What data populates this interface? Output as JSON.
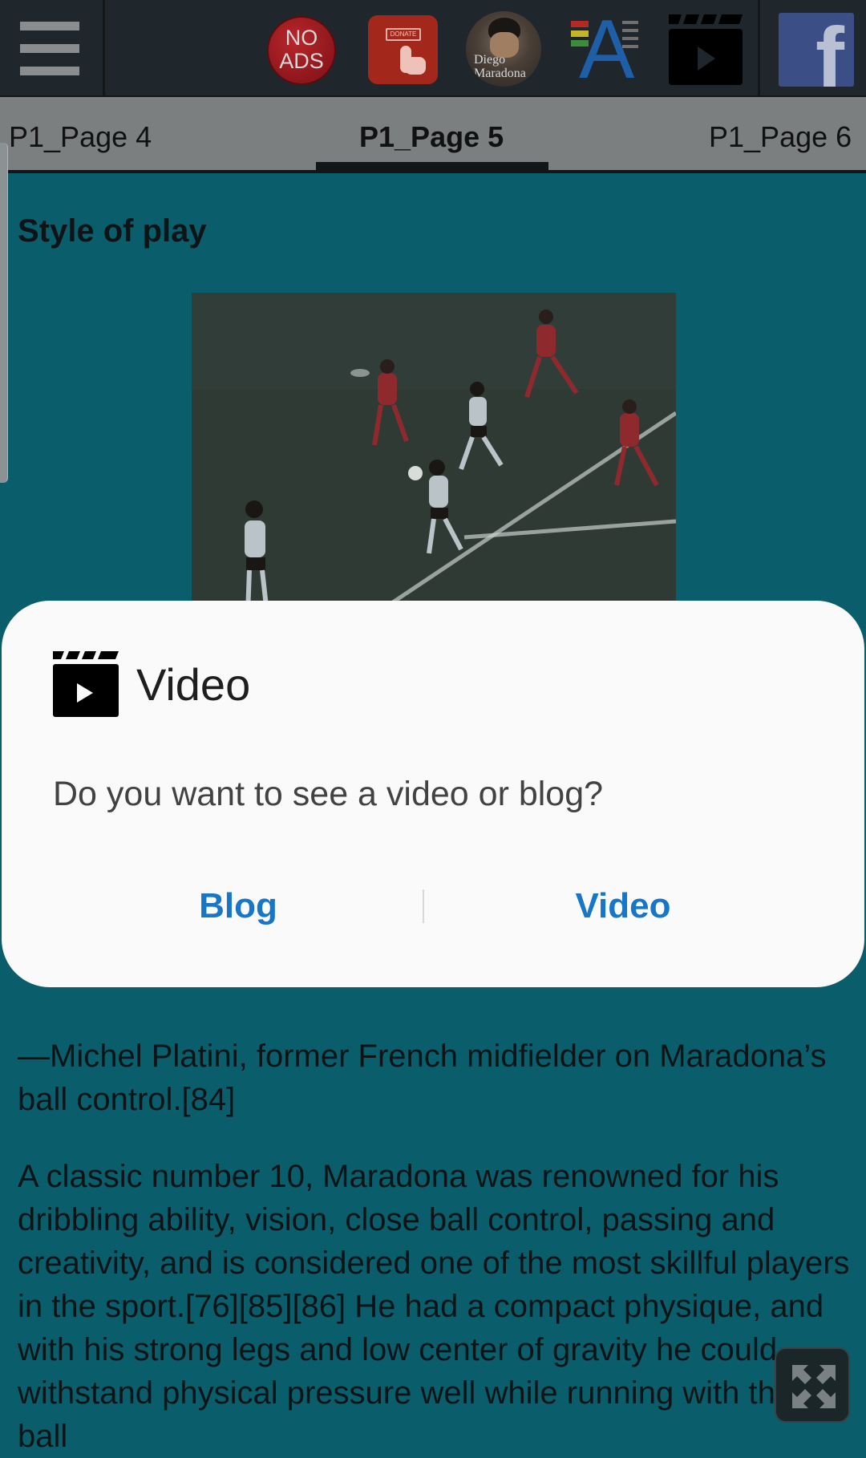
{
  "toolbar": {
    "menu_icon": "hamburger-menu-icon",
    "no_ads_line1": "NO",
    "no_ads_line2": "ADS",
    "donate_label": "DONATE",
    "avatar_line1": "Diego",
    "avatar_line2": "Maradona",
    "font_icon": "font-size-icon",
    "video_icon": "clapperboard-icon",
    "facebook_icon": "facebook-icon"
  },
  "tabs": [
    {
      "label": "P1_Page 4"
    },
    {
      "label": "P1_Page 5",
      "active": true
    },
    {
      "label": "P1_Page 6"
    }
  ],
  "content": {
    "heading": "Style of play",
    "quote": "—Michel Platini, former French midfielder on Maradona’s ball control.[84]",
    "paragraph": "A classic number 10, Maradona was renowned for his dribbling ability, vision, close ball control, passing and creativity, and is considered one of the most skillful players in the sport.[76][85][86] He had a compact physique, and with his strong legs and low center of gravity he could withstand physical pressure well while running with the ball"
  },
  "dialog": {
    "title": "Video",
    "message": "Do you want to see a video or blog?",
    "blog_label": "Blog",
    "video_label": "Video"
  },
  "colors": {
    "accent": "#1876c7",
    "page_bg": "#0a5d6b",
    "toolbar_bg": "#1f272c"
  }
}
